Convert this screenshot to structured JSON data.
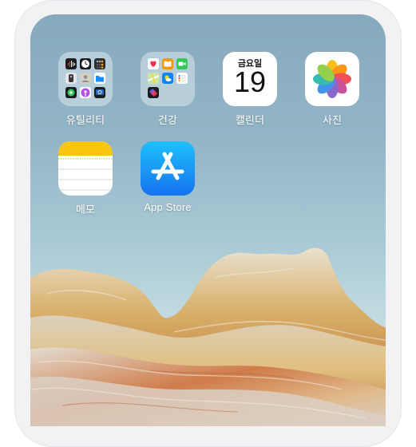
{
  "home_screen": {
    "apps": [
      {
        "label": "유틸리티",
        "icon": "utilities-folder-icon"
      },
      {
        "label": "건강",
        "icon": "health-folder-icon"
      },
      {
        "label": "캘린더",
        "icon": "calendar-icon",
        "weekday": "금요일",
        "day": "19"
      },
      {
        "label": "사진",
        "icon": "photos-icon"
      },
      {
        "label": "메모",
        "icon": "notes-icon"
      },
      {
        "label": "App Store",
        "icon": "app-store-icon"
      }
    ]
  },
  "colors": {
    "frame": "#f2f2f4",
    "sky": "#92b5c6",
    "app_store_blue": "#1673f0",
    "notes_yellow": "#f8c60f"
  }
}
